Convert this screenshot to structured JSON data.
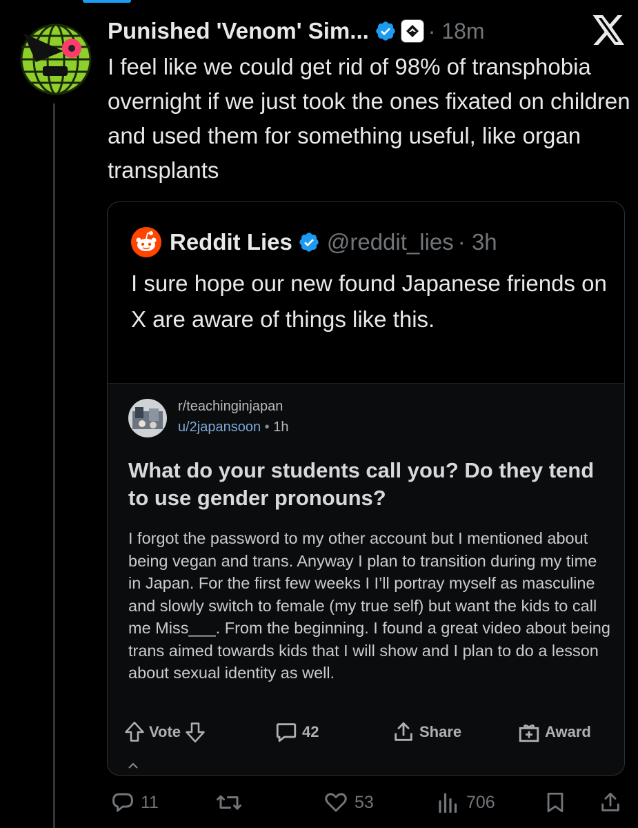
{
  "tweet": {
    "author_name": "Punished 'Venom' Sim...",
    "time": "· 18m",
    "text": "I feel like we could get rid of 98% of transphobia overnight if we just took the ones fixated on children and used them for something useful, like organ transplants",
    "stats": {
      "replies": "11",
      "retweets": "",
      "likes": "53",
      "views": "706"
    }
  },
  "quote": {
    "author_name": "Reddit Lies",
    "handle": "@reddit_lies",
    "time": "· 3h",
    "text": "I sure hope our new found Japanese friends on X are aware of things like this."
  },
  "reddit_post": {
    "subreddit": "r/teachinginjapan",
    "username": "u/2japansoon",
    "time": "1h",
    "title": "What do your students call you? Do they tend to use gender pronouns?",
    "body": "I forgot the password to my other account but I mentioned about being vegan and trans. Anyway I plan to transition during my time in Japan. For the first few weeks I I’ll portray myself as masculine and  slowly switch to female (my true self) but want the kids to call me Miss___. From the beginning. I found a great video about being trans aimed towards kids that I will show and I plan to do a lesson about sexual identity as well.",
    "actions": {
      "vote": "Vote",
      "comments": "42",
      "share": "Share",
      "award": "Award"
    }
  },
  "icons": {
    "verified": "verified-badge-icon",
    "x_logo": "x-logo-icon",
    "reddit_logo": "reddit-logo-icon"
  },
  "colors": {
    "background": "#000000",
    "verified": "#1d9bf0",
    "reddit": "#ff4500",
    "muted": "#71767b"
  }
}
